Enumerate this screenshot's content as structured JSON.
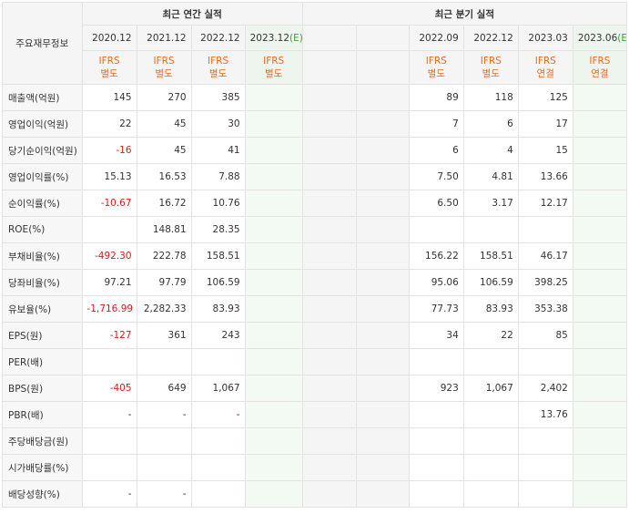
{
  "header": {
    "row_header_label": "주요재무정보",
    "annual_title": "최근 연간 실적",
    "quarterly_title": "최근 분기 실적",
    "annual_periods": [
      "2020.12",
      "2021.12",
      "2022.12",
      "2023.12"
    ],
    "annual_estimate_mark": "(E)",
    "quarterly_periods": [
      "2022.09",
      "2022.12",
      "2023.03",
      "2023.06"
    ],
    "quarterly_estimate_mark": "(E)",
    "annual_basis": [
      "IFRS\n별도",
      "IFRS\n별도",
      "IFRS\n별도",
      "IFRS\n별도"
    ],
    "quarterly_basis": [
      "IFRS\n별도",
      "IFRS\n별도",
      "IFRS\n연결",
      "IFRS\n연결"
    ]
  },
  "rows": [
    {
      "label": "매출액(억원)",
      "annual": [
        "145",
        "270",
        "385",
        ""
      ],
      "quarterly": [
        "89",
        "118",
        "125",
        ""
      ]
    },
    {
      "label": "영업이익(억원)",
      "annual": [
        "22",
        "45",
        "30",
        ""
      ],
      "quarterly": [
        "7",
        "6",
        "17",
        ""
      ]
    },
    {
      "label": "당기순이익(억원)",
      "annual": [
        "-16",
        "45",
        "41",
        ""
      ],
      "quarterly": [
        "6",
        "4",
        "15",
        ""
      ]
    },
    {
      "label": "영업이익률(%)",
      "annual": [
        "15.13",
        "16.53",
        "7.88",
        ""
      ],
      "quarterly": [
        "7.50",
        "4.81",
        "13.66",
        ""
      ]
    },
    {
      "label": "순이익률(%)",
      "annual": [
        "-10.67",
        "16.72",
        "10.76",
        ""
      ],
      "quarterly": [
        "6.50",
        "3.17",
        "12.17",
        ""
      ]
    },
    {
      "label": "ROE(%)",
      "annual": [
        "",
        "148.81",
        "28.35",
        ""
      ],
      "quarterly": [
        "",
        "",
        "",
        ""
      ]
    },
    {
      "label": "부채비율(%)",
      "annual": [
        "-492.30",
        "222.78",
        "158.51",
        ""
      ],
      "quarterly": [
        "156.22",
        "158.51",
        "46.17",
        ""
      ]
    },
    {
      "label": "당좌비율(%)",
      "annual": [
        "97.21",
        "97.79",
        "106.59",
        ""
      ],
      "quarterly": [
        "95.06",
        "106.59",
        "398.25",
        ""
      ]
    },
    {
      "label": "유보율(%)",
      "annual": [
        "-1,716.99",
        "2,282.33",
        "83.93",
        ""
      ],
      "quarterly": [
        "77.73",
        "83.93",
        "353.38",
        ""
      ]
    },
    {
      "label": "EPS(원)",
      "annual": [
        "-127",
        "361",
        "243",
        ""
      ],
      "quarterly": [
        "34",
        "22",
        "85",
        ""
      ]
    },
    {
      "label": "PER(배)",
      "annual": [
        "",
        "",
        "",
        ""
      ],
      "quarterly": [
        "",
        "",
        "",
        ""
      ]
    },
    {
      "label": "BPS(원)",
      "annual": [
        "-405",
        "649",
        "1,067",
        ""
      ],
      "quarterly": [
        "923",
        "1,067",
        "2,402",
        ""
      ]
    },
    {
      "label": "PBR(배)",
      "annual": [
        "-",
        "-",
        "-",
        ""
      ],
      "quarterly": [
        "",
        "",
        "13.76",
        ""
      ]
    },
    {
      "label": "주당배당금(원)",
      "annual": [
        "",
        "",
        "",
        ""
      ],
      "quarterly": [
        "",
        "",
        "",
        ""
      ]
    },
    {
      "label": "시가배당률(%)",
      "annual": [
        "",
        "",
        "",
        ""
      ],
      "quarterly": [
        "",
        "",
        "",
        ""
      ]
    },
    {
      "label": "배당성향(%)",
      "annual": [
        "-",
        "-",
        "",
        ""
      ],
      "quarterly": [
        "",
        "",
        "",
        ""
      ]
    }
  ],
  "colors": {
    "negative": "#d21c1c",
    "basis_label": "#ec6a1d",
    "estimate_mark": "#35a13b",
    "estimate_bg": "#f3f9f3"
  }
}
